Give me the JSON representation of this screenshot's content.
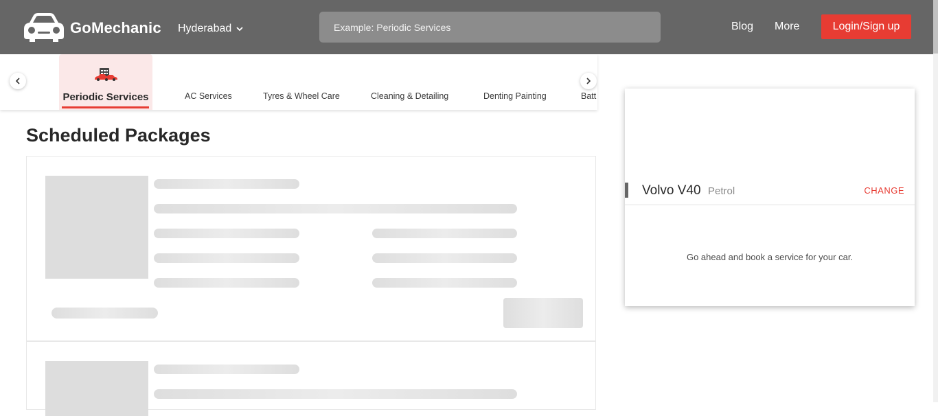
{
  "header": {
    "brand": "GoMechanic",
    "city": "Hyderabad",
    "search_placeholder": "Example: Periodic Services",
    "nav": {
      "blog": "Blog",
      "more": "More"
    },
    "login_label": "Login/Sign up"
  },
  "categories": {
    "active": "Periodic Services",
    "items": [
      "AC Services",
      "Tyres & Wheel Care",
      "Cleaning & Detailing",
      "Denting Painting",
      "Batt"
    ]
  },
  "main": {
    "title": "Scheduled Packages"
  },
  "car_panel": {
    "model": "Volvo V40",
    "fuel": "Petrol",
    "change_label": "CHANGE",
    "message": "Go ahead and book a service for your car."
  },
  "colors": {
    "header_bg": "#666666",
    "accent": "#e73c33",
    "active_tab_bg": "#fbe8e8",
    "skeleton": "#dddddd"
  },
  "icons": {
    "logo": "car-logo-icon",
    "city_dropdown": "chevron-down-icon",
    "prev": "chevron-left-icon",
    "next": "chevron-right-icon",
    "periodic_services": "car-service-icon"
  }
}
